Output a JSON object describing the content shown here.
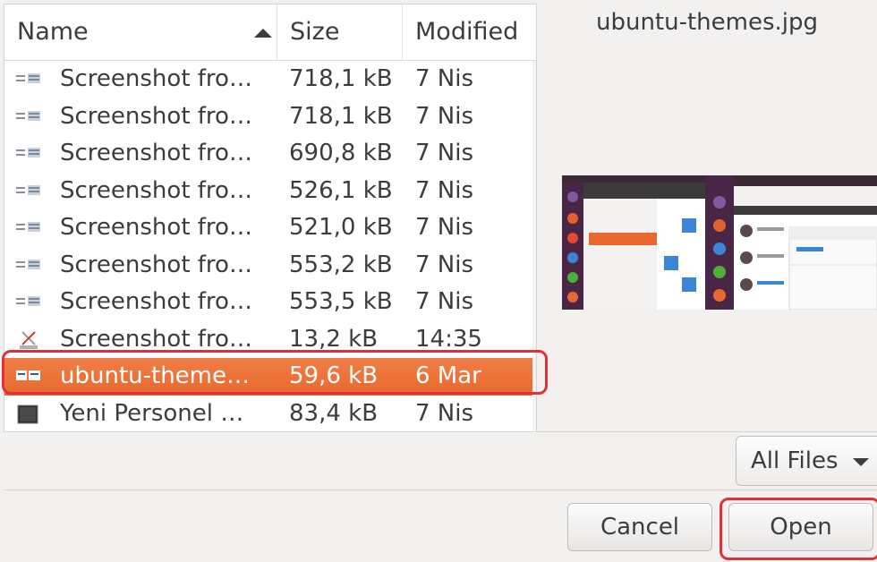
{
  "columns": {
    "name": "Name",
    "size": "Size",
    "modified": "Modified"
  },
  "files": [
    {
      "name": "Screenshot fro…",
      "size": "718,1 kB",
      "modified": "7 Nis",
      "icon": "image-thumbnail-icon",
      "selected": false
    },
    {
      "name": "Screenshot fro…",
      "size": "718,1 kB",
      "modified": "7 Nis",
      "icon": "image-thumbnail-icon",
      "selected": false
    },
    {
      "name": "Screenshot fro…",
      "size": "690,8 kB",
      "modified": "7 Nis",
      "icon": "image-thumbnail-icon",
      "selected": false
    },
    {
      "name": "Screenshot fro…",
      "size": "526,1 kB",
      "modified": "7 Nis",
      "icon": "image-thumbnail-icon",
      "selected": false
    },
    {
      "name": "Screenshot fro…",
      "size": "521,0 kB",
      "modified": "7 Nis",
      "icon": "image-thumbnail-icon",
      "selected": false
    },
    {
      "name": "Screenshot fro…",
      "size": "553,2 kB",
      "modified": "7 Nis",
      "icon": "image-thumbnail-icon",
      "selected": false
    },
    {
      "name": "Screenshot fro…",
      "size": "553,5 kB",
      "modified": "7 Nis",
      "icon": "image-thumbnail-icon",
      "selected": false
    },
    {
      "name": "Screenshot fro…",
      "size": "13,2 kB",
      "modified": "14:35",
      "icon": "image-broken-icon",
      "selected": false
    },
    {
      "name": "ubuntu-theme…",
      "size": "59,6 kB",
      "modified": "6 Mar",
      "icon": "image-thumbnail-icon",
      "selected": true
    },
    {
      "name": "Yeni Personel …",
      "size": "83,4 kB",
      "modified": "7 Nis",
      "icon": "terminal-thumbnail-icon",
      "selected": false
    }
  ],
  "preview": {
    "title": "ubuntu-themes.jpg"
  },
  "filter": {
    "selected": "All Files"
  },
  "buttons": {
    "cancel": "Cancel",
    "open": "Open"
  },
  "colors": {
    "selection": "#e9682e",
    "highlight": "#e0303a",
    "text": "#3c3c3c"
  }
}
